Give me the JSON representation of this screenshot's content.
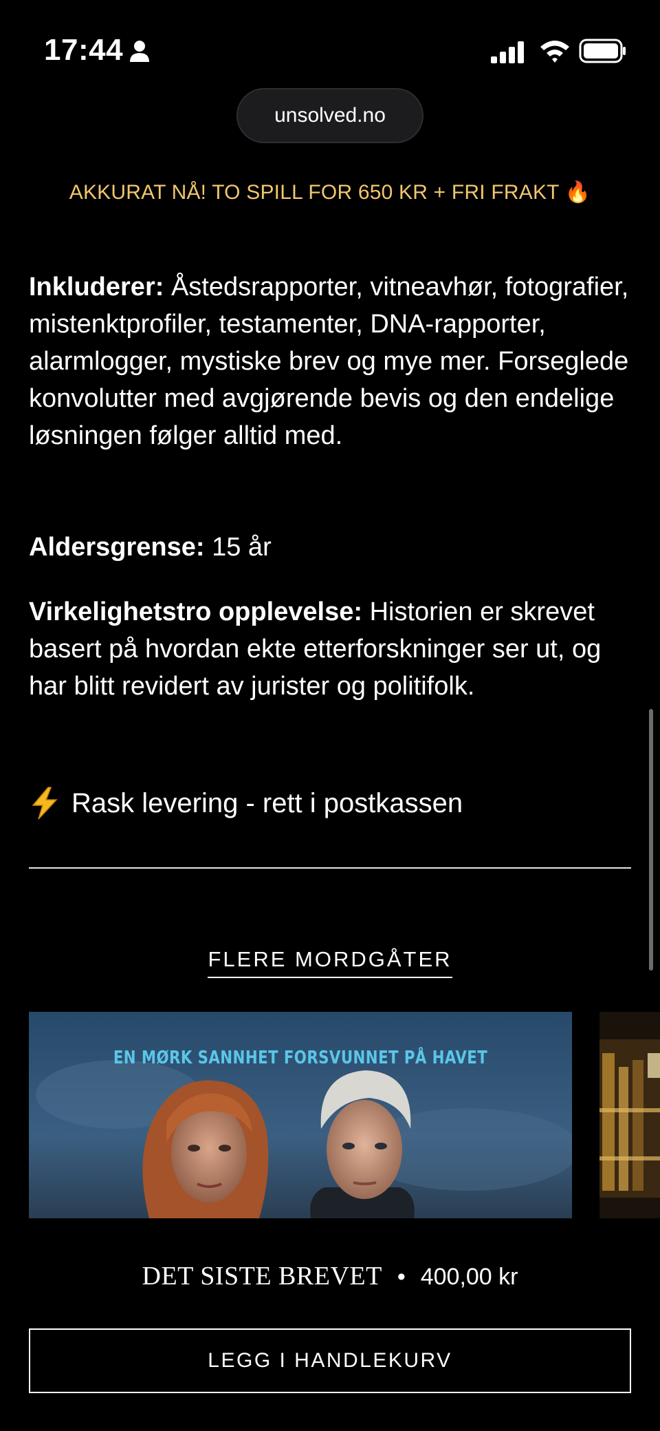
{
  "status_bar": {
    "time": "17:44"
  },
  "browser": {
    "url": "unsolved.no"
  },
  "promo": {
    "text": "AKKURAT NÅ! TO SPILL FOR 650 KR + FRI FRAKT 🔥"
  },
  "details": {
    "includes_label": "Inkluderer:",
    "includes_text": " Åstedsrapporter, vitneavhør, fotografier, mistenktprofiler, testamenter, DNA-rapporter, alarmlogger, mystiske brev og mye mer. Forseglede konvolutter med avgjørende bevis og den endelige løsningen følger alltid med.",
    "age_label": "Aldersgrense:",
    "age_value": " 15 år",
    "realism_label": "Virkelighetstro opplevelse:",
    "realism_text": " Historien er skrevet basert på hvordan ekte etterforskninger ser ut, og har blitt revidert av jurister og politifolk.",
    "delivery_text": "Rask levering - rett i postkassen"
  },
  "more_section": {
    "title": "FLERE MORDGÅTER"
  },
  "product": {
    "image_tagline": "EN MØRK SANNHET FORSVUNNET PÅ HAVET",
    "name": "DET SISTE BREVET",
    "separator": "•",
    "price": "400,00 kr",
    "add_to_cart_label": "LEGG I HANDLEKURV"
  },
  "colors": {
    "background": "#000000",
    "promo": "#f2c66d",
    "tagline": "#5bc6e8"
  }
}
